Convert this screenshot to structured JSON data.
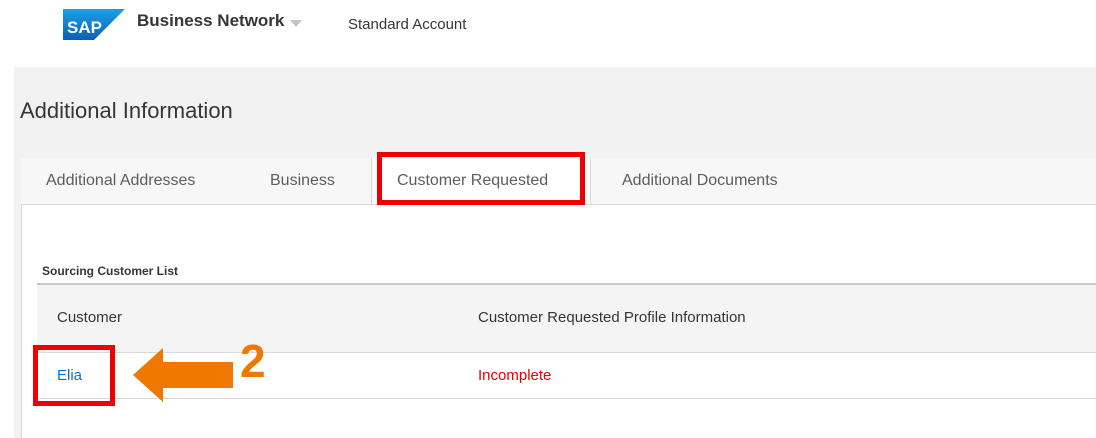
{
  "header": {
    "logo_text": "SAP",
    "product_name": "Business Network",
    "account_type": "Standard Account"
  },
  "page": {
    "title": "Additional Information"
  },
  "tabs": [
    {
      "label": "Additional Addresses"
    },
    {
      "label": "Business"
    },
    {
      "label": "Customer Requested"
    },
    {
      "label": "Additional Documents"
    }
  ],
  "active_tab": "Customer Requested",
  "section": {
    "label": "Sourcing Customer List"
  },
  "table": {
    "columns": [
      "Customer",
      "Customer Requested Profile Information"
    ],
    "rows": [
      {
        "customer": "Elia",
        "status": "Incomplete"
      }
    ]
  },
  "annotation": {
    "step_number": "2",
    "arrow_color": "#f07800",
    "highlight_color": "#ee0000"
  },
  "colors": {
    "sap_blue": "#0a6ed1",
    "status_incomplete": "#e60000"
  }
}
